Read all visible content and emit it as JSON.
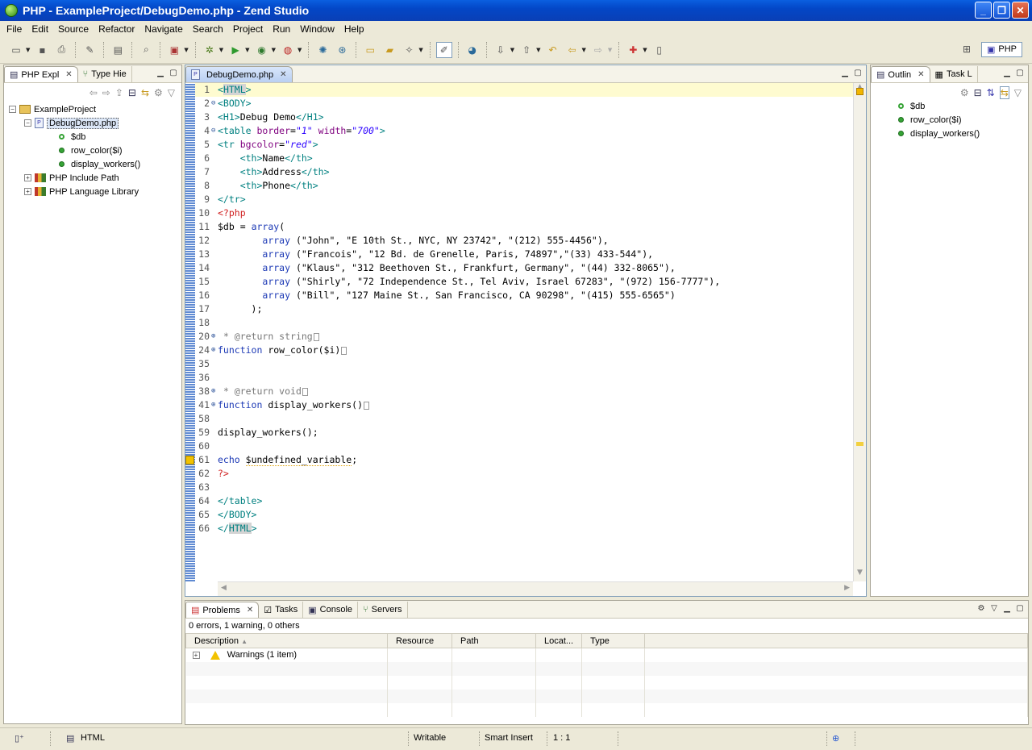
{
  "window": {
    "title": "PHP - ExampleProject/DebugDemo.php - Zend Studio"
  },
  "menu": [
    "File",
    "Edit",
    "Source",
    "Refactor",
    "Navigate",
    "Search",
    "Project",
    "Run",
    "Window",
    "Help"
  ],
  "perspective": {
    "label": "PHP"
  },
  "explorer": {
    "tabs": [
      {
        "label": "PHP Expl"
      },
      {
        "label": "Type Hie"
      }
    ],
    "tree": {
      "project": "ExampleProject",
      "file": "DebugDemo.php",
      "members": [
        "$db",
        "row_color($i)",
        "display_workers()"
      ],
      "include_path": "PHP Include Path",
      "language_library": "PHP Language Library"
    }
  },
  "editor": {
    "tab_label": "DebugDemo.php",
    "lines": [
      {
        "n": "1",
        "html": "<span class='tag'>&lt;<span class='hlbox'>HTML</span>&gt;</span>"
      },
      {
        "n": "2",
        "html": "<span class='tag'>&lt;BODY&gt;</span>"
      },
      {
        "n": "3",
        "html": "<span class='tag'>&lt;H1&gt;</span>Debug Demo<span class='tag'>&lt;/H1&gt;</span>"
      },
      {
        "n": "4",
        "html": "<span class='tag'>&lt;table </span><span class='attr'>border</span>=<span class='str'>\"1\"</span> <span class='attr'>width</span>=<span class='str'>\"700\"</span><span class='tag'>&gt;</span>"
      },
      {
        "n": "5",
        "html": "<span class='tag'>&lt;tr </span><span class='attr'>bgcolor</span>=<span class='str'>\"red\"</span><span class='tag'>&gt;</span>"
      },
      {
        "n": "6",
        "html": "    <span class='tag'>&lt;th&gt;</span>Name<span class='tag'>&lt;/th&gt;</span>"
      },
      {
        "n": "7",
        "html": "    <span class='tag'>&lt;th&gt;</span>Address<span class='tag'>&lt;/th&gt;</span>"
      },
      {
        "n": "8",
        "html": "    <span class='tag'>&lt;th&gt;</span>Phone<span class='tag'>&lt;/th&gt;</span>"
      },
      {
        "n": "9",
        "html": "<span class='tag'>&lt;/tr&gt;</span>"
      },
      {
        "n": "10",
        "html": "<span class='php'>&lt;?php</span>"
      },
      {
        "n": "11",
        "html": "<span class='var'>$db</span> = <span class='kw'>array</span>("
      },
      {
        "n": "12",
        "html": "        <span class='kw'>array</span> (\"John\", \"E 10th St., NYC, NY 23742\", \"(212) 555-4456\"),"
      },
      {
        "n": "13",
        "html": "        <span class='kw'>array</span> (\"Francois\", \"12 Bd. de Grenelle, Paris, 74897\",\"(33) 433-544\"),"
      },
      {
        "n": "14",
        "html": "        <span class='kw'>array</span> (\"Klaus\", \"312 Beethoven St., Frankfurt, Germany\", \"(44) 332-8065\"),"
      },
      {
        "n": "15",
        "html": "        <span class='kw'>array</span> (\"Shirly\", \"72 Independence St., Tel Aviv, Israel 67283\", \"(972) 156-7777\"),"
      },
      {
        "n": "16",
        "html": "        <span class='kw'>array</span> (\"Bill\", \"127 Maine St., San Francisco, CA 90298\", \"(415) 555-6565\")"
      },
      {
        "n": "17",
        "html": "      );"
      },
      {
        "n": "18",
        "html": ""
      },
      {
        "n": "20",
        "html": " <span class='comment'>* @return string</span><span class='collapsed'></span>"
      },
      {
        "n": "24",
        "html": "<span class='kw'>function</span> row_color($i)<span class='collapsed'></span>"
      },
      {
        "n": "35",
        "html": ""
      },
      {
        "n": "36",
        "html": ""
      },
      {
        "n": "38",
        "html": " <span class='comment'>* @return void</span><span class='collapsed'></span>"
      },
      {
        "n": "41",
        "html": "<span class='kw'>function</span> display_workers()<span class='collapsed'></span>"
      },
      {
        "n": "58",
        "html": ""
      },
      {
        "n": "59",
        "html": "display_workers();"
      },
      {
        "n": "60",
        "html": ""
      },
      {
        "n": "61",
        "html": "<span class='kw'>echo</span> <span class='squig'>$undefined_variable</span>;"
      },
      {
        "n": "62",
        "html": "<span class='php'>?&gt;</span>"
      },
      {
        "n": "63",
        "html": ""
      },
      {
        "n": "64",
        "html": "<span class='tag'>&lt;/table&gt;</span>"
      },
      {
        "n": "65",
        "html": "<span class='tag'>&lt;/BODY&gt;</span>"
      },
      {
        "n": "66",
        "html": "<span class='tag'>&lt;/<span class='hlbox'>HTML</span>&gt;</span>"
      }
    ]
  },
  "outline": {
    "tabs": [
      {
        "label": "Outlin"
      },
      {
        "label": "Task L"
      }
    ],
    "items": [
      "$db",
      "row_color($i)",
      "display_workers()"
    ]
  },
  "bottom": {
    "tabs": [
      {
        "label": "Problems"
      },
      {
        "label": "Tasks"
      },
      {
        "label": "Console"
      },
      {
        "label": "Servers"
      }
    ],
    "summary": "0 errors, 1 warning, 0 others",
    "columns": [
      "Description",
      "Resource",
      "Path",
      "Locat...",
      "Type"
    ],
    "rows": [
      {
        "description": "Warnings (1 item)"
      }
    ]
  },
  "status": {
    "language": "HTML",
    "writable": "Writable",
    "insert_mode": "Smart Insert",
    "position": "1 : 1"
  }
}
